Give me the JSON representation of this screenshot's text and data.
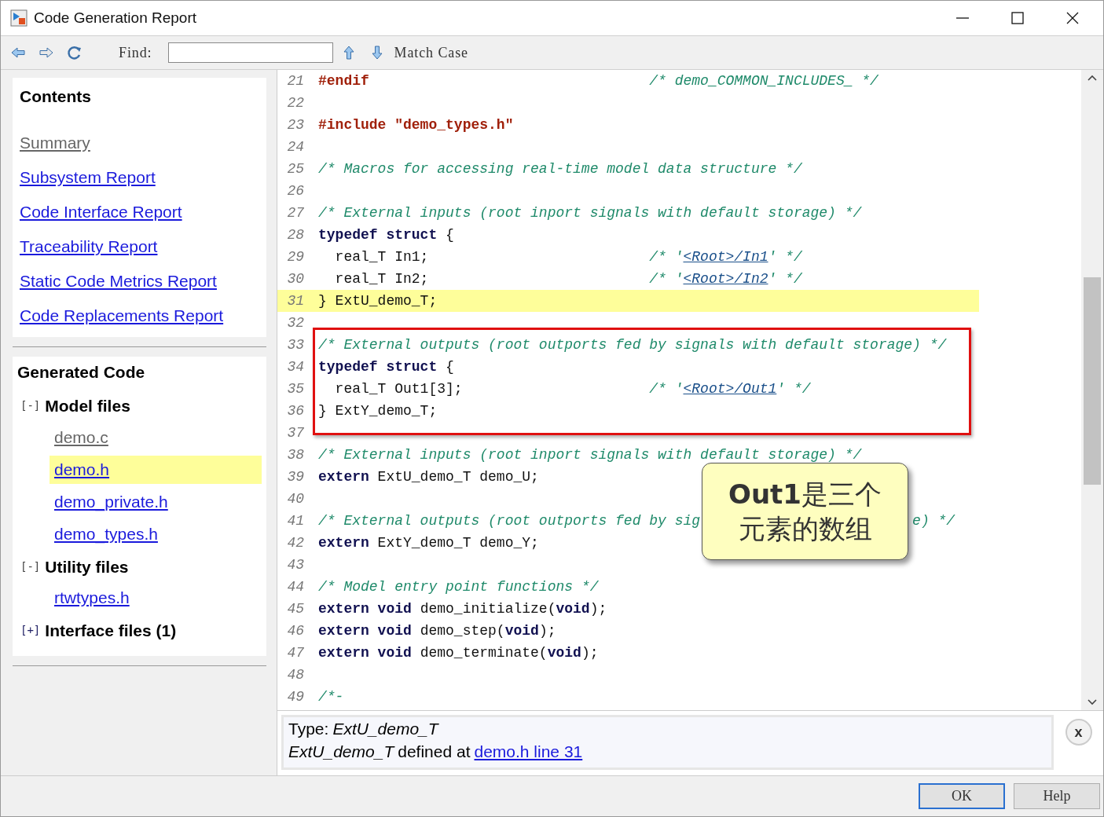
{
  "window": {
    "title": "Code Generation Report"
  },
  "toolbar": {
    "find_label": "Find:",
    "match_case": "Match Case"
  },
  "contents": {
    "title": "Contents",
    "links": [
      {
        "label": "Summary",
        "visited": true
      },
      {
        "label": "Subsystem Report",
        "visited": false
      },
      {
        "label": "Code Interface Report",
        "visited": false
      },
      {
        "label": "Traceability Report",
        "visited": false
      },
      {
        "label": "Static Code Metrics Report",
        "visited": false
      },
      {
        "label": "Code Replacements Report",
        "visited": false
      }
    ]
  },
  "generated_code": {
    "title": "Generated Code",
    "groups": [
      {
        "toggle": "[-]",
        "label": "Model files",
        "expanded": true,
        "files": [
          {
            "label": "demo.c",
            "visited": true,
            "selected": false
          },
          {
            "label": "demo.h",
            "visited": false,
            "selected": true
          },
          {
            "label": "demo_private.h",
            "visited": false,
            "selected": false
          },
          {
            "label": "demo_types.h",
            "visited": false,
            "selected": false
          }
        ]
      },
      {
        "toggle": "[-]",
        "label": "Utility files",
        "expanded": true,
        "files": [
          {
            "label": "rtwtypes.h",
            "visited": false,
            "selected": false
          }
        ]
      },
      {
        "toggle": "[+]",
        "label": "Interface files (1)",
        "expanded": false
      }
    ]
  },
  "code": {
    "lines": [
      {
        "number": "21",
        "selected": false,
        "segments": [
          {
            "kind": "pre",
            "text": "#endif"
          }
        ],
        "aside": [
          {
            "kind": "cmt",
            "text": "/* demo_COMMON_INCLUDES_ */"
          }
        ]
      },
      {
        "number": "22",
        "selected": false
      },
      {
        "number": "23",
        "selected": false,
        "segments": [
          {
            "kind": "pre",
            "text": "#include \"demo_types.h\""
          }
        ]
      },
      {
        "number": "24",
        "selected": false
      },
      {
        "number": "25",
        "selected": false,
        "segments": [
          {
            "kind": "cmt",
            "text": "/* Macros for accessing real-time model data structure */"
          }
        ]
      },
      {
        "number": "26",
        "selected": false
      },
      {
        "number": "27",
        "selected": false,
        "segments": [
          {
            "kind": "cmt",
            "text": "/* External inputs (root inport signals with default storage) */"
          }
        ]
      },
      {
        "number": "28",
        "selected": false,
        "segments": [
          {
            "kind": "kw",
            "text": "typedef struct"
          },
          {
            "kind": "plain",
            "text": " {"
          }
        ]
      },
      {
        "number": "29",
        "selected": false,
        "segments": [
          {
            "kind": "plain",
            "text": "  real_T In1;"
          }
        ],
        "aside": [
          {
            "kind": "cmt",
            "text": "/* '"
          },
          {
            "kind": "link",
            "text": "<Root>/In1"
          },
          {
            "kind": "cmt",
            "text": "' */"
          }
        ]
      },
      {
        "number": "30",
        "selected": false,
        "segments": [
          {
            "kind": "plain",
            "text": "  real_T In2;"
          }
        ],
        "aside": [
          {
            "kind": "cmt",
            "text": "/* '"
          },
          {
            "kind": "link",
            "text": "<Root>/In2"
          },
          {
            "kind": "cmt",
            "text": "' */"
          }
        ]
      },
      {
        "number": "31",
        "selected": true,
        "segments": [
          {
            "kind": "plain",
            "text": "} ExtU_demo_T;"
          }
        ]
      },
      {
        "number": "32",
        "selected": false
      },
      {
        "number": "33",
        "selected": false,
        "segments": [
          {
            "kind": "cmt",
            "text": "/* External outputs (root outports fed by signals with default storage) */"
          }
        ]
      },
      {
        "number": "34",
        "selected": false,
        "segments": [
          {
            "kind": "kw",
            "text": "typedef struct"
          },
          {
            "kind": "plain",
            "text": " {"
          }
        ]
      },
      {
        "number": "35",
        "selected": false,
        "segments": [
          {
            "kind": "plain",
            "text": "  real_T Out1[3];"
          }
        ],
        "aside": [
          {
            "kind": "cmt",
            "text": "/* '"
          },
          {
            "kind": "link",
            "text": "<Root>/Out1"
          },
          {
            "kind": "cmt",
            "text": "' */"
          }
        ]
      },
      {
        "number": "36",
        "selected": false,
        "segments": [
          {
            "kind": "plain",
            "text": "} ExtY_demo_T;"
          }
        ]
      },
      {
        "number": "37",
        "selected": false
      },
      {
        "number": "38",
        "selected": false,
        "segments": [
          {
            "kind": "cmt",
            "text": "/* External inputs (root inport signals with default storage) */"
          }
        ]
      },
      {
        "number": "39",
        "selected": false,
        "segments": [
          {
            "kind": "kw",
            "text": "extern"
          },
          {
            "kind": "plain",
            "text": " ExtU_demo_T demo_U;"
          }
        ]
      },
      {
        "number": "40",
        "selected": false
      },
      {
        "number": "41",
        "selected": false,
        "segments": [
          {
            "kind": "cmt",
            "text": "/* External outputs (root outports fed by sig"
          }
        ],
        "tail": [
          {
            "kind": "cmt",
            "text": "e) */"
          }
        ]
      },
      {
        "number": "42",
        "selected": false,
        "segments": [
          {
            "kind": "kw",
            "text": "extern"
          },
          {
            "kind": "plain",
            "text": " ExtY_demo_T demo_Y;"
          }
        ]
      },
      {
        "number": "43",
        "selected": false
      },
      {
        "number": "44",
        "selected": false,
        "segments": [
          {
            "kind": "cmt",
            "text": "/* Model entry point functions */"
          }
        ]
      },
      {
        "number": "45",
        "selected": false,
        "segments": [
          {
            "kind": "kw",
            "text": "extern void"
          },
          {
            "kind": "plain",
            "text": " demo_initialize("
          },
          {
            "kind": "kw",
            "text": "void"
          },
          {
            "kind": "plain",
            "text": ");"
          }
        ]
      },
      {
        "number": "46",
        "selected": false,
        "segments": [
          {
            "kind": "kw",
            "text": "extern void"
          },
          {
            "kind": "plain",
            "text": " demo_step("
          },
          {
            "kind": "kw",
            "text": "void"
          },
          {
            "kind": "plain",
            "text": ");"
          }
        ]
      },
      {
        "number": "47",
        "selected": false,
        "segments": [
          {
            "kind": "kw",
            "text": "extern void"
          },
          {
            "kind": "plain",
            "text": " demo_terminate("
          },
          {
            "kind": "kw",
            "text": "void"
          },
          {
            "kind": "plain",
            "text": ");"
          }
        ]
      },
      {
        "number": "48",
        "selected": false
      },
      {
        "number": "49",
        "selected": false,
        "segments": [
          {
            "kind": "cmt",
            "text": "/*-"
          }
        ]
      }
    ]
  },
  "callout": {
    "lines": [
      "**Out1**是三个",
      "元素的数组"
    ]
  },
  "info": {
    "type_label": "Type:",
    "type_value": "ExtU_demo_T",
    "def_name": "ExtU_demo_T",
    "def_text": "defined at",
    "def_link": "demo.h line 31",
    "close": "x"
  },
  "buttons": [
    "OK",
    "Help"
  ]
}
